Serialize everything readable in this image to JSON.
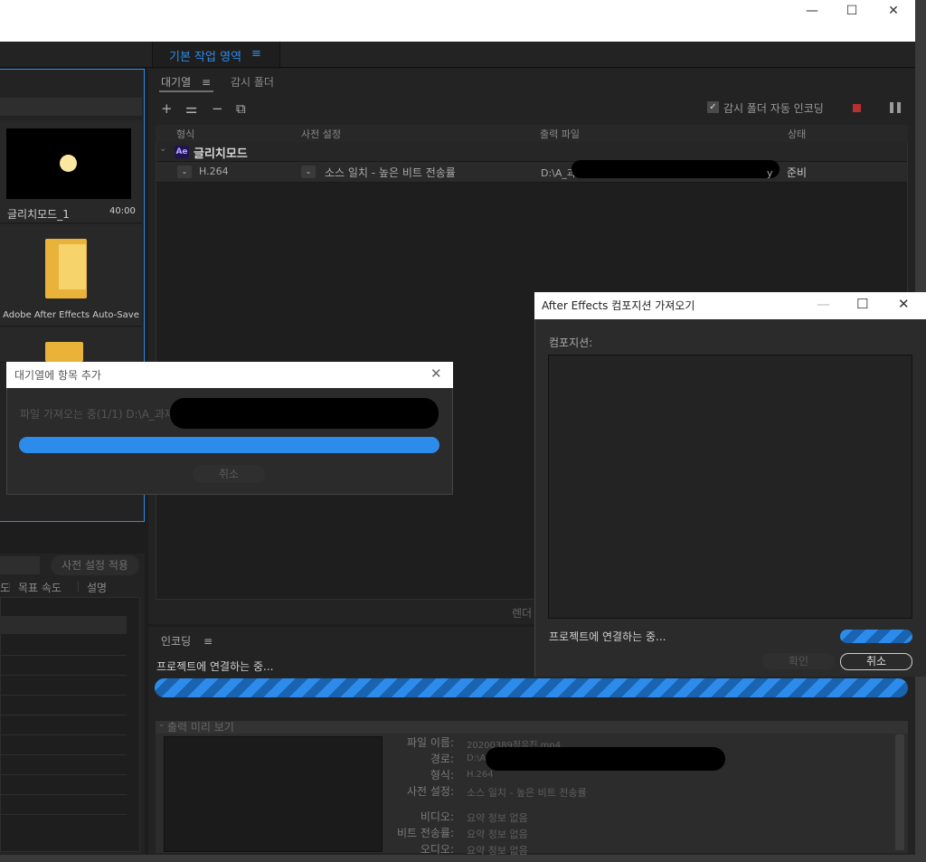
{
  "window": {
    "minimize": "—",
    "maximize": "☐",
    "close": "✕"
  },
  "workspace": {
    "label": "기본 작업 영역",
    "menu": "≡"
  },
  "project": {
    "items": [
      {
        "name": "글리치모드_1",
        "duration": "40:00"
      },
      {
        "name": "Adobe After Effects Auto-Save"
      }
    ]
  },
  "queue": {
    "tab_queue": "대기열",
    "tab_menu": "≡",
    "tab_watch": "감시 폴더",
    "tools": {
      "add": "+",
      "settings": "⚌",
      "remove": "−",
      "duplicate": "⧉"
    },
    "auto_encode": "감시 폴더 자동 인코딩",
    "columns": {
      "format": "형식",
      "preset": "사전 설정",
      "output": "출력 파일",
      "status": "상태"
    },
    "group": {
      "badge": "Ae",
      "name": "글리치모드"
    },
    "row": {
      "format": "H.264",
      "preset": "소스 일치 - 높은 비트 전송률",
      "output": "D:\\A_과",
      "output_tail": "y",
      "status": "준비"
    },
    "render_label": "렌더"
  },
  "presets": {
    "apply_button": "사전 설정 적용",
    "col_prefix": "도",
    "col_speed": "목표 속도",
    "col_desc": "설명"
  },
  "encoding": {
    "tab": "인코딩",
    "tab_menu": "≡",
    "status": "프로젝트에 연결하는 중...",
    "preview_header": "출력 미리 보기",
    "details": {
      "filename_label": "파일 이름:",
      "filename_value": "20200389정유진.mp4",
      "path_label": "경로:",
      "path_value": "D:\\A",
      "format_label": "형식:",
      "format_value": "H.264",
      "preset_label": "사전 설정:",
      "preset_value": "소스 일치 - 높은 비트 전송률",
      "video_label": "비디오:",
      "video_value": "요약 정보 없음",
      "bitrate_label": "비트 전송률:",
      "bitrate_value": "요약 정보 없음",
      "audio_label": "오디오:",
      "audio_value": "요약 정보 없음"
    }
  },
  "dialog_add": {
    "title": "대기열에 항목 추가",
    "close": "✕",
    "message": "파일 가져오는 중(1/1) D:\\A_과제",
    "cancel": "취소"
  },
  "dialog_import": {
    "title": "After Effects 컴포지션 가져오기",
    "minimize": "—",
    "maximize": "☐",
    "close": "✕",
    "comp_label": "컴포지션:",
    "connecting": "프로젝트에 연결하는 중...",
    "ok": "확인",
    "cancel": "취소"
  },
  "colors": {
    "accent": "#2d8ceb",
    "panel": "#232323",
    "stop": "#b83030"
  },
  "icons": {
    "checkbox": "✓",
    "pause": "❚❚",
    "chevron": "⌄"
  }
}
